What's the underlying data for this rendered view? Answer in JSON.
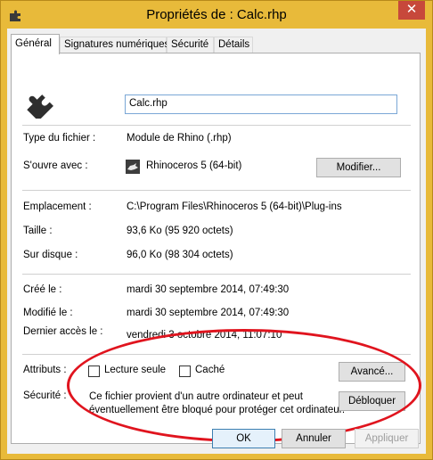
{
  "window": {
    "title": "Propriétés de : Calc.rhp",
    "close_glyph": "✕",
    "accent": "#e8ba3a"
  },
  "tabs": [
    {
      "label": "Général"
    },
    {
      "label": "Signatures numériques"
    },
    {
      "label": "Sécurité"
    },
    {
      "label": "Détails"
    }
  ],
  "general": {
    "file_name": "Calc.rhp",
    "file_type_label": "Type du fichier :",
    "file_type_value": "Module de Rhino (.rhp)",
    "opens_with_label": "S'ouvre avec :",
    "opens_with_value": "Rhinoceros 5 (64-bit)",
    "change_button": "Modifier...",
    "location_label": "Emplacement :",
    "location_value": "C:\\Program Files\\Rhinoceros 5 (64-bit)\\Plug-ins",
    "size_label": "Taille :",
    "size_value": "93,6 Ko (95 920 octets)",
    "size_on_disk_label": "Sur disque :",
    "size_on_disk_value": "96,0 Ko (98 304 octets)",
    "created_label": "Créé le :",
    "created_value": "mardi 30 septembre 2014, 07:49:30",
    "modified_label": "Modifié le :",
    "modified_value": "mardi 30 septembre 2014, 07:49:30",
    "accessed_label": "Dernier accès le :",
    "accessed_value": "vendredi 3 octobre 2014, 11:07:10",
    "attributes_label": "Attributs :",
    "readonly_label": "Lecture seule",
    "hidden_label": "Caché",
    "advanced_button": "Avancé...",
    "security_label": "Sécurité :",
    "security_line1": "Ce fichier provient d'un autre ordinateur et peut",
    "security_line2": "éventuellement être bloqué pour protéger cet ordinateur.",
    "unblock_button": "Débloquer"
  },
  "footer": {
    "ok": "OK",
    "cancel": "Annuler",
    "apply": "Appliquer"
  }
}
